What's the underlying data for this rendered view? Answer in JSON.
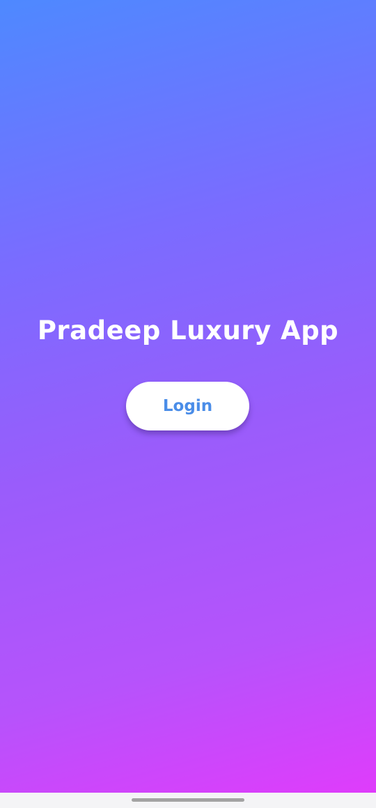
{
  "app": {
    "title": "Pradeep Luxury App"
  },
  "actions": {
    "login_label": "Login"
  },
  "colors": {
    "gradient_start": "#4e89ff",
    "gradient_end": "#df3cfb",
    "button_background": "#ffffff",
    "button_text": "#4a8de8"
  },
  "system": {
    "nav_bar_background": "#f4f4f6",
    "home_indicator": "gesture-bar"
  }
}
